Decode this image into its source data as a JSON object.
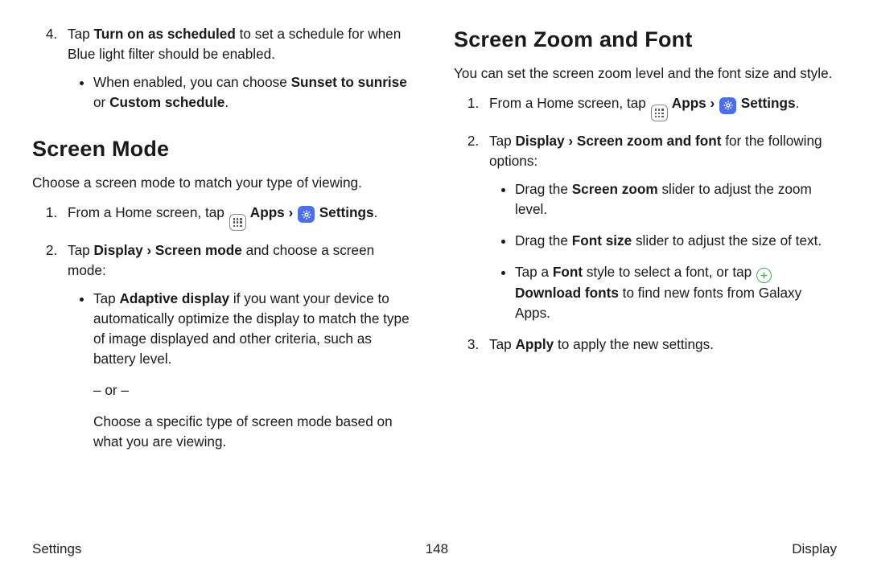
{
  "left": {
    "step4_pre": "Tap ",
    "step4_bold": "Turn on as scheduled",
    "step4_post": " to set a schedule for when Blue light filter should be enabled.",
    "step4_bullet_pre": "When enabled, you can choose ",
    "step4_bullet_bold1": "Sunset to sunrise",
    "step4_bullet_mid": " or ",
    "step4_bullet_bold2": "Custom schedule",
    "step4_bullet_post": ".",
    "heading": "Screen Mode",
    "intro": "Choose a screen mode to match your type of viewing.",
    "s1_pre": "From a Home screen, tap ",
    "s1_apps": " Apps",
    "s1_chev": " › ",
    "s1_settings": " Settings",
    "s1_post": ".",
    "s2_pre": "Tap ",
    "s2_bold": "Display › Screen mode",
    "s2_post": " and choose a screen mode:",
    "s2_b1_pre": "Tap ",
    "s2_b1_bold": "Adaptive display",
    "s2_b1_post": " if you want your device to automatically optimize the display to match the type of image displayed and other criteria, such as battery level.",
    "or": "– or –",
    "s2_b1_alt": "Choose a specific type of screen mode based on what you are viewing."
  },
  "right": {
    "heading": "Screen Zoom and Font",
    "intro": "You can set the screen zoom level and the font size and style.",
    "s1_pre": "From a Home screen, tap ",
    "s1_apps": " Apps",
    "s1_chev": " › ",
    "s1_settings": " Settings",
    "s1_post": ".",
    "s2_pre": "Tap ",
    "s2_bold": "Display › Screen zoom and font",
    "s2_post": " for the following options:",
    "b1_pre": "Drag the ",
    "b1_bold": "Screen zoom",
    "b1_post": " slider to adjust the zoom level.",
    "b2_pre": "Drag the ",
    "b2_bold": "Font size",
    "b2_post": " slider to adjust the size of text.",
    "b3_pre": "Tap a ",
    "b3_bold1": "Font",
    "b3_mid": " style to select a font, or tap ",
    "b3_bold2": " Download fonts",
    "b3_post": " to find new fonts from Galaxy Apps.",
    "s3_pre": "Tap ",
    "s3_bold": "Apply",
    "s3_post": " to apply the new settings."
  },
  "footer": {
    "left": "Settings",
    "center": "148",
    "right": "Display"
  }
}
